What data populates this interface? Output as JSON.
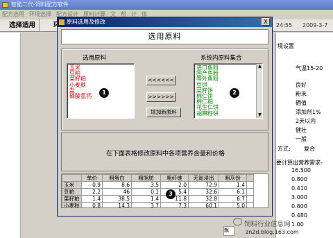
{
  "app": {
    "title": "智能二代-饲料配方软件",
    "menu": [
      "配方选用",
      "环境选择",
      "配方设计",
      "原料计算",
      "文",
      "帮",
      "计",
      "体"
    ],
    "toolbar": {
      "item1": "选择适用",
      "item2": "环",
      "time": "24:55",
      "date": "2009-3-7"
    },
    "right_panel": {
      "settings_label": "境设置",
      "temp": "气温15-20",
      "items": [
        "良好",
        "粉末",
        "硒值",
        "添加剂1%",
        "2天以内",
        "健壮",
        "一般"
      ],
      "method_label": "方式:",
      "method_value": "复合",
      "nutrient_label": "要计算出营养需求-",
      "values": [
        "16.500",
        "0.800",
        "0.410",
        "3.000",
        "0.800",
        "0.480",
        "1.00"
      ]
    }
  },
  "dialog": {
    "title": "原料选用及修改",
    "close_label": "X",
    "heading": "选用原料",
    "selected_label": "选用原料",
    "system_label": "系统内原料集合",
    "selected_items": [
      "玉米",
      "豆粕",
      "菜籽粕",
      "小麦麸",
      "盐",
      "磷酸氢钙"
    ],
    "system_items": [
      "进口鱼粉",
      "国产鱼粉",
      "等外鱼粉",
      "豆饼",
      "菜籽饼",
      "棉仁饼",
      "棉仁粕",
      "花生仁饼",
      "胡麻籽饼"
    ],
    "btn_add_left": "<<<<<<",
    "btn_remove_right": ">>>>>>",
    "btn_new": "增加新原料",
    "instruction": "在下面表格修改原料中各项营养含量和价格",
    "grid": {
      "headers": [
        "",
        "单价",
        "粗蛋白",
        "粗脂肪",
        "粗纤维",
        "无氮浸出",
        "粗灰份",
        ""
      ],
      "rows": [
        [
          "玉米",
          "0.9",
          "8.6",
          "3.5",
          "2.0",
          "72.9",
          "1.4"
        ],
        [
          "豆粕",
          "2.2",
          "46",
          "0.1",
          "5.4",
          "32.6",
          "6.1"
        ],
        [
          "菜籽粕",
          "1.4",
          "38.5",
          "1.4",
          "11.8",
          "32.8",
          "6.7"
        ],
        [
          "小麦麸",
          "0.8",
          "14.3",
          "3.7",
          "7.3",
          "60.1",
          "5.0"
        ]
      ]
    },
    "badges": [
      "1",
      "2",
      "3"
    ]
  },
  "watermark": {
    "text": "饲料行业信息网",
    "url": "zn2d.blog.163.com",
    "taskbar_text": "飘"
  }
}
